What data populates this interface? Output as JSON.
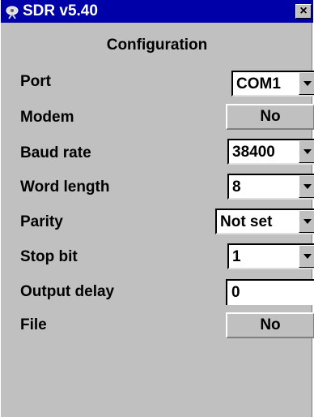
{
  "window": {
    "title": "SDR v5.40",
    "close_label": "×"
  },
  "header": {
    "title": "Configuration"
  },
  "fields": {
    "port": {
      "label": "Port",
      "value": "COM1"
    },
    "modem": {
      "label": "Modem",
      "value": "No"
    },
    "baud_rate": {
      "label": "Baud rate",
      "value": "38400"
    },
    "word_length": {
      "label": "Word length",
      "value": "8"
    },
    "parity": {
      "label": "Parity",
      "value": "Not set"
    },
    "stop_bit": {
      "label": "Stop bit",
      "value": "1"
    },
    "output_delay": {
      "label": "Output delay",
      "value": "0"
    },
    "file": {
      "label": "File",
      "value": "No"
    }
  },
  "icons": {
    "app": "satellite-dish-icon",
    "dropdown": "chevron-down-icon"
  },
  "colors": {
    "titlebar": "#0000a8",
    "face": "#c0c0c0"
  }
}
